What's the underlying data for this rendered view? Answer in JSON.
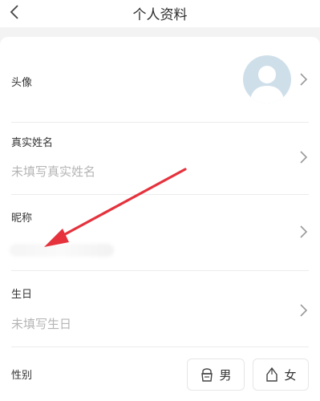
{
  "header": {
    "title": "个人资料",
    "back_icon": "chevron-left-icon"
  },
  "rows": {
    "avatar": {
      "label": "头像"
    },
    "real_name": {
      "label": "真实姓名",
      "placeholder": "未填写真实姓名"
    },
    "nickname": {
      "label": "昵称"
    },
    "birthday": {
      "label": "生日",
      "placeholder": "未填写生日"
    },
    "gender": {
      "label": "性别",
      "male": "男",
      "female": "女"
    }
  },
  "colors": {
    "annotation_arrow": "#e5323d",
    "avatar_bg": "#cfdfea",
    "placeholder": "#b5b5b5"
  }
}
